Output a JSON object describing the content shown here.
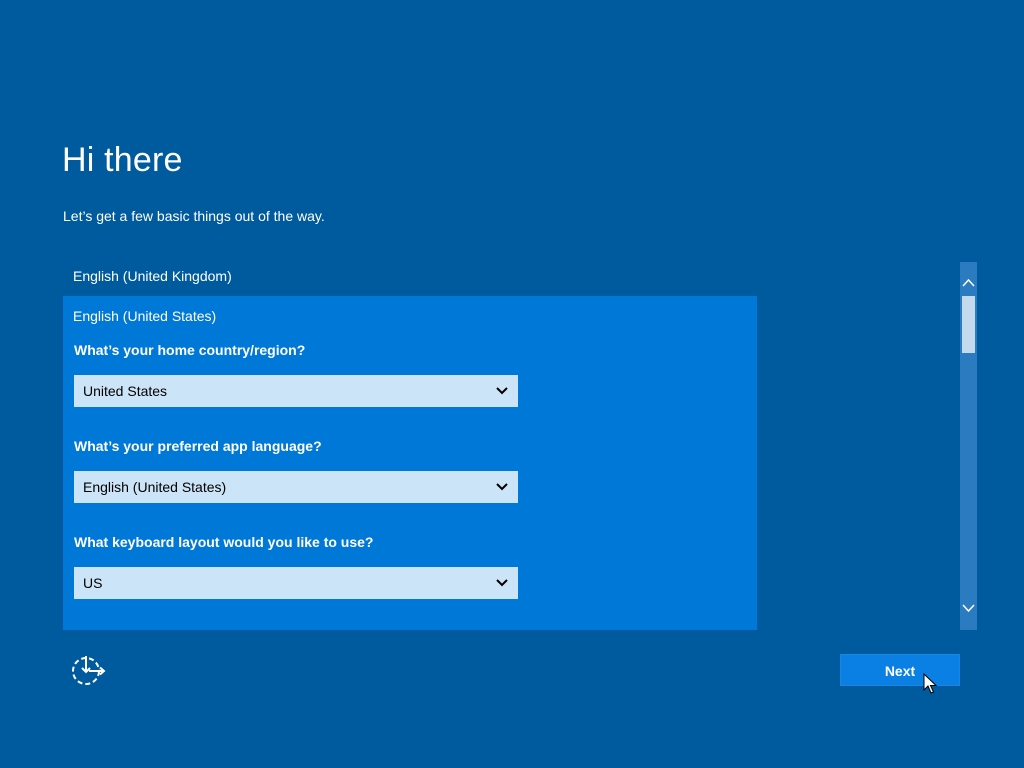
{
  "header": {
    "title": "Hi there",
    "subtitle": "Let’s get a few basic things out of the way."
  },
  "language_list": {
    "items": [
      {
        "label": "English (United Kingdom)",
        "selected": false
      },
      {
        "label": "English (United States)",
        "selected": true
      }
    ]
  },
  "settings": {
    "country": {
      "question": "What’s your home country/region?",
      "value": "United States"
    },
    "app_language": {
      "question": "What’s your preferred app language?",
      "value": "English (United States)"
    },
    "keyboard": {
      "question": "What keyboard layout would you like to use?",
      "value": "US"
    }
  },
  "footer": {
    "next_label": "Next",
    "ease_of_access_icon": "ease-of-access-icon"
  },
  "colors": {
    "background": "#005a9e",
    "selected_item": "#0078d7",
    "select_field": "#cce4f7",
    "next_button": "#0a80e4"
  }
}
